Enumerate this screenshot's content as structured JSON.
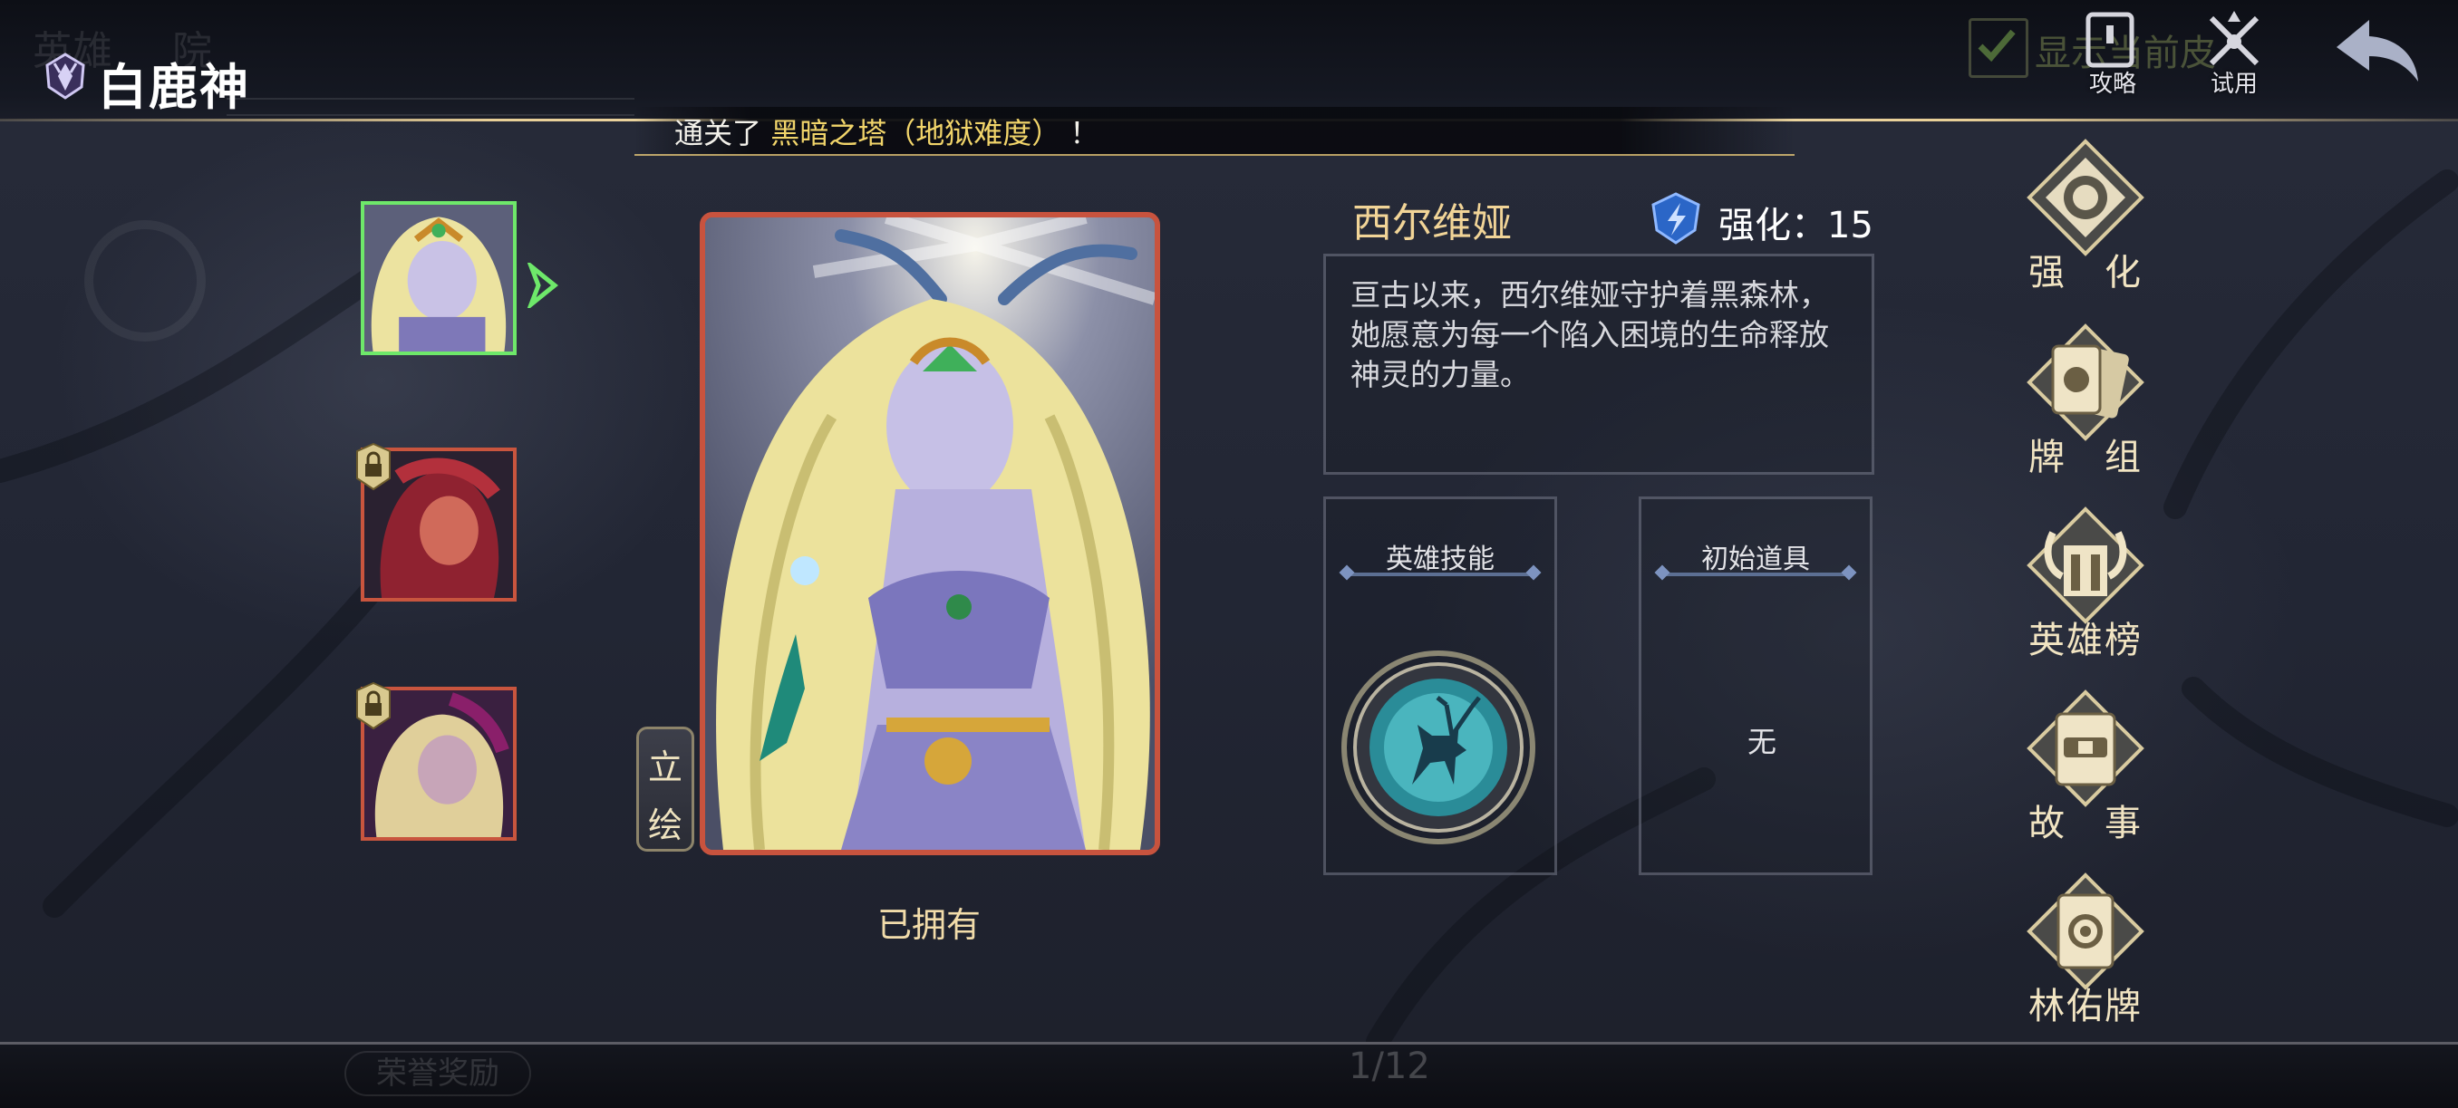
{
  "header": {
    "title": "白鹿神",
    "ghost_tabs": [
      "英雄",
      "院"
    ],
    "show_current_label": "显示当前皮",
    "strategy_label": "攻略",
    "trial_label": "试用"
  },
  "notice": {
    "prefix": "通关了",
    "highlight": "黑暗之塔（地狱难度）",
    "suffix": "！"
  },
  "hero_list": [
    {
      "state": "selected"
    },
    {
      "state": "locked"
    },
    {
      "state": "locked"
    }
  ],
  "portrait": {
    "tab_label_1": "立",
    "tab_label_2": "绘",
    "owned_label": "已拥有"
  },
  "hero": {
    "name": "西尔维娅",
    "level_label": "强化：15",
    "description": "亘古以来，西尔维娅守护着黑森林，她愿意为每一个陷入困境的生命释放神灵的力量。"
  },
  "panels": {
    "skill_title": "英雄技能",
    "item_title": "初始道具",
    "item_value": "无"
  },
  "menu": [
    {
      "label": "强　化",
      "icon": "enhance-icon"
    },
    {
      "label": "牌　组",
      "icon": "deck-icon"
    },
    {
      "label": "英雄榜",
      "icon": "ranking-icon"
    },
    {
      "label": "故　事",
      "icon": "story-icon"
    },
    {
      "label": "林佑牌",
      "icon": "forest-card-icon"
    }
  ],
  "footer": {
    "honor_reward_label": "荣誉奖励",
    "page_indicator": "1/12"
  },
  "colors": {
    "accent_gold": "#f1d497",
    "frame_red": "#c8533e",
    "selected_green": "#6ee86a",
    "highlight_yellow": "#f1d46a"
  }
}
